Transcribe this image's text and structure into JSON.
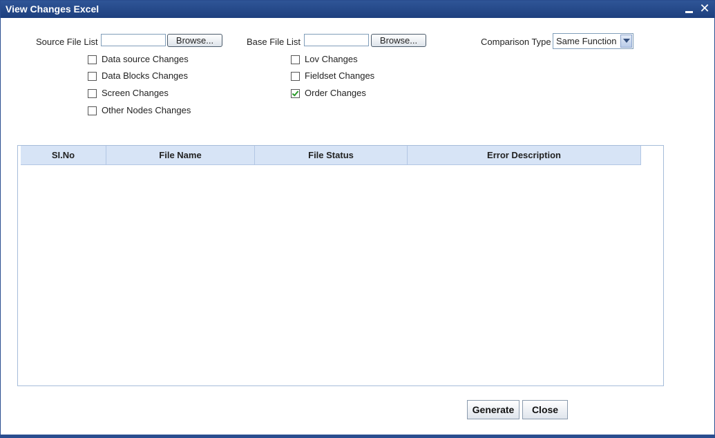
{
  "window": {
    "title": "View Changes Excel"
  },
  "form": {
    "source_label": "Source File List",
    "source_value": "",
    "source_browse": "Browse...",
    "base_label": "Base File List",
    "base_value": "",
    "base_browse": "Browse...",
    "comparison_label": "Comparison Type",
    "comparison_value": "Same Function"
  },
  "checkboxes": [
    {
      "label": "Data source Changes",
      "checked": false
    },
    {
      "label": "Data Blocks Changes",
      "checked": false
    },
    {
      "label": "Screen Changes",
      "checked": false
    },
    {
      "label": "Other Nodes Changes",
      "checked": false
    },
    {
      "label": "Lov Changes",
      "checked": false
    },
    {
      "label": "Fieldset Changes",
      "checked": false
    },
    {
      "label": "Order Changes",
      "checked": true
    }
  ],
  "table": {
    "columns": [
      "SI.No",
      "File Name",
      "File Status",
      "Error Description"
    ],
    "rows": []
  },
  "actions": {
    "generate": "Generate",
    "close": "Close"
  },
  "colors": {
    "titlebar": "#2f5597",
    "header_bg": "#d7e4f6",
    "check": "#2a9a2a"
  }
}
